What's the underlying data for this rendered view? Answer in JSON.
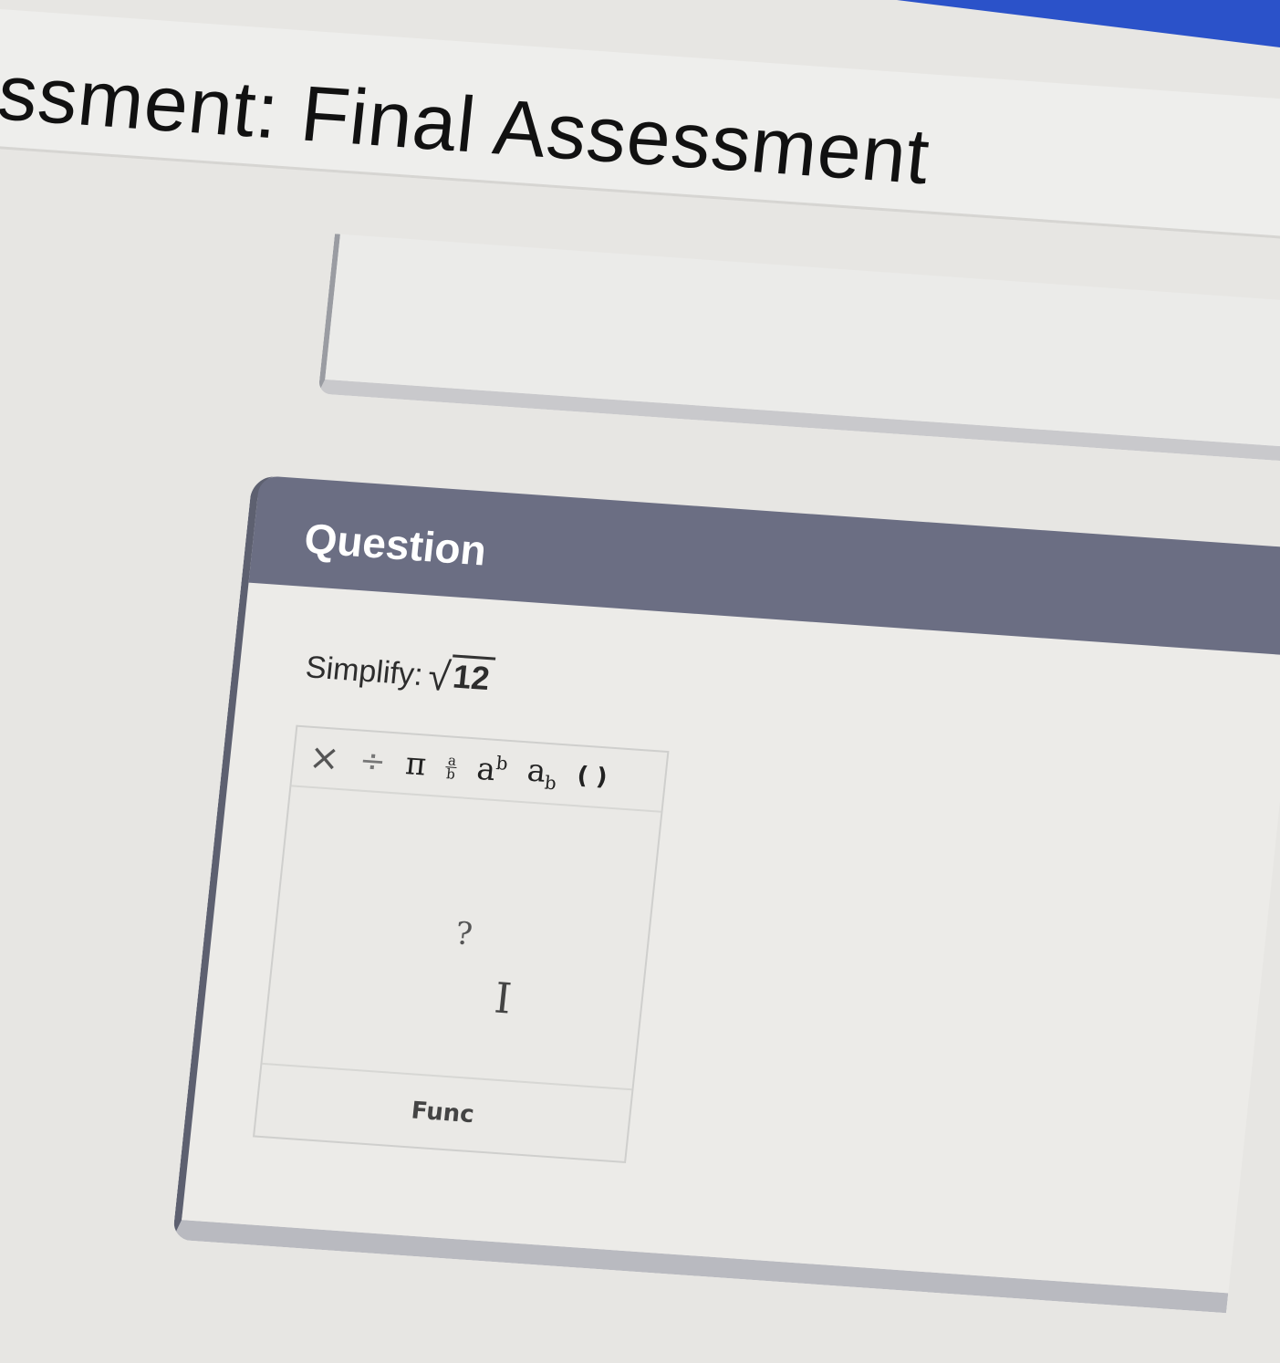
{
  "header": {
    "title": "essment: Final Assessment"
  },
  "question": {
    "heading": "Question",
    "prompt_label": "Simplify:",
    "radicand": "12",
    "radical_symbol": "√"
  },
  "editor": {
    "toolbar": {
      "times": "×",
      "divide": "÷",
      "pi": "π",
      "frac_top": "a",
      "frac_bottom": "b",
      "power_base": "a",
      "power_exp": "b",
      "sub_base": "a",
      "sub_index": "b",
      "parens": "( )"
    },
    "placeholder": "?",
    "cursor_glyph": "I",
    "tabs": [
      {
        "label": "Func"
      }
    ]
  },
  "colors": {
    "question_header": "#6b6e83",
    "corner_accent": "#2b52c9"
  }
}
